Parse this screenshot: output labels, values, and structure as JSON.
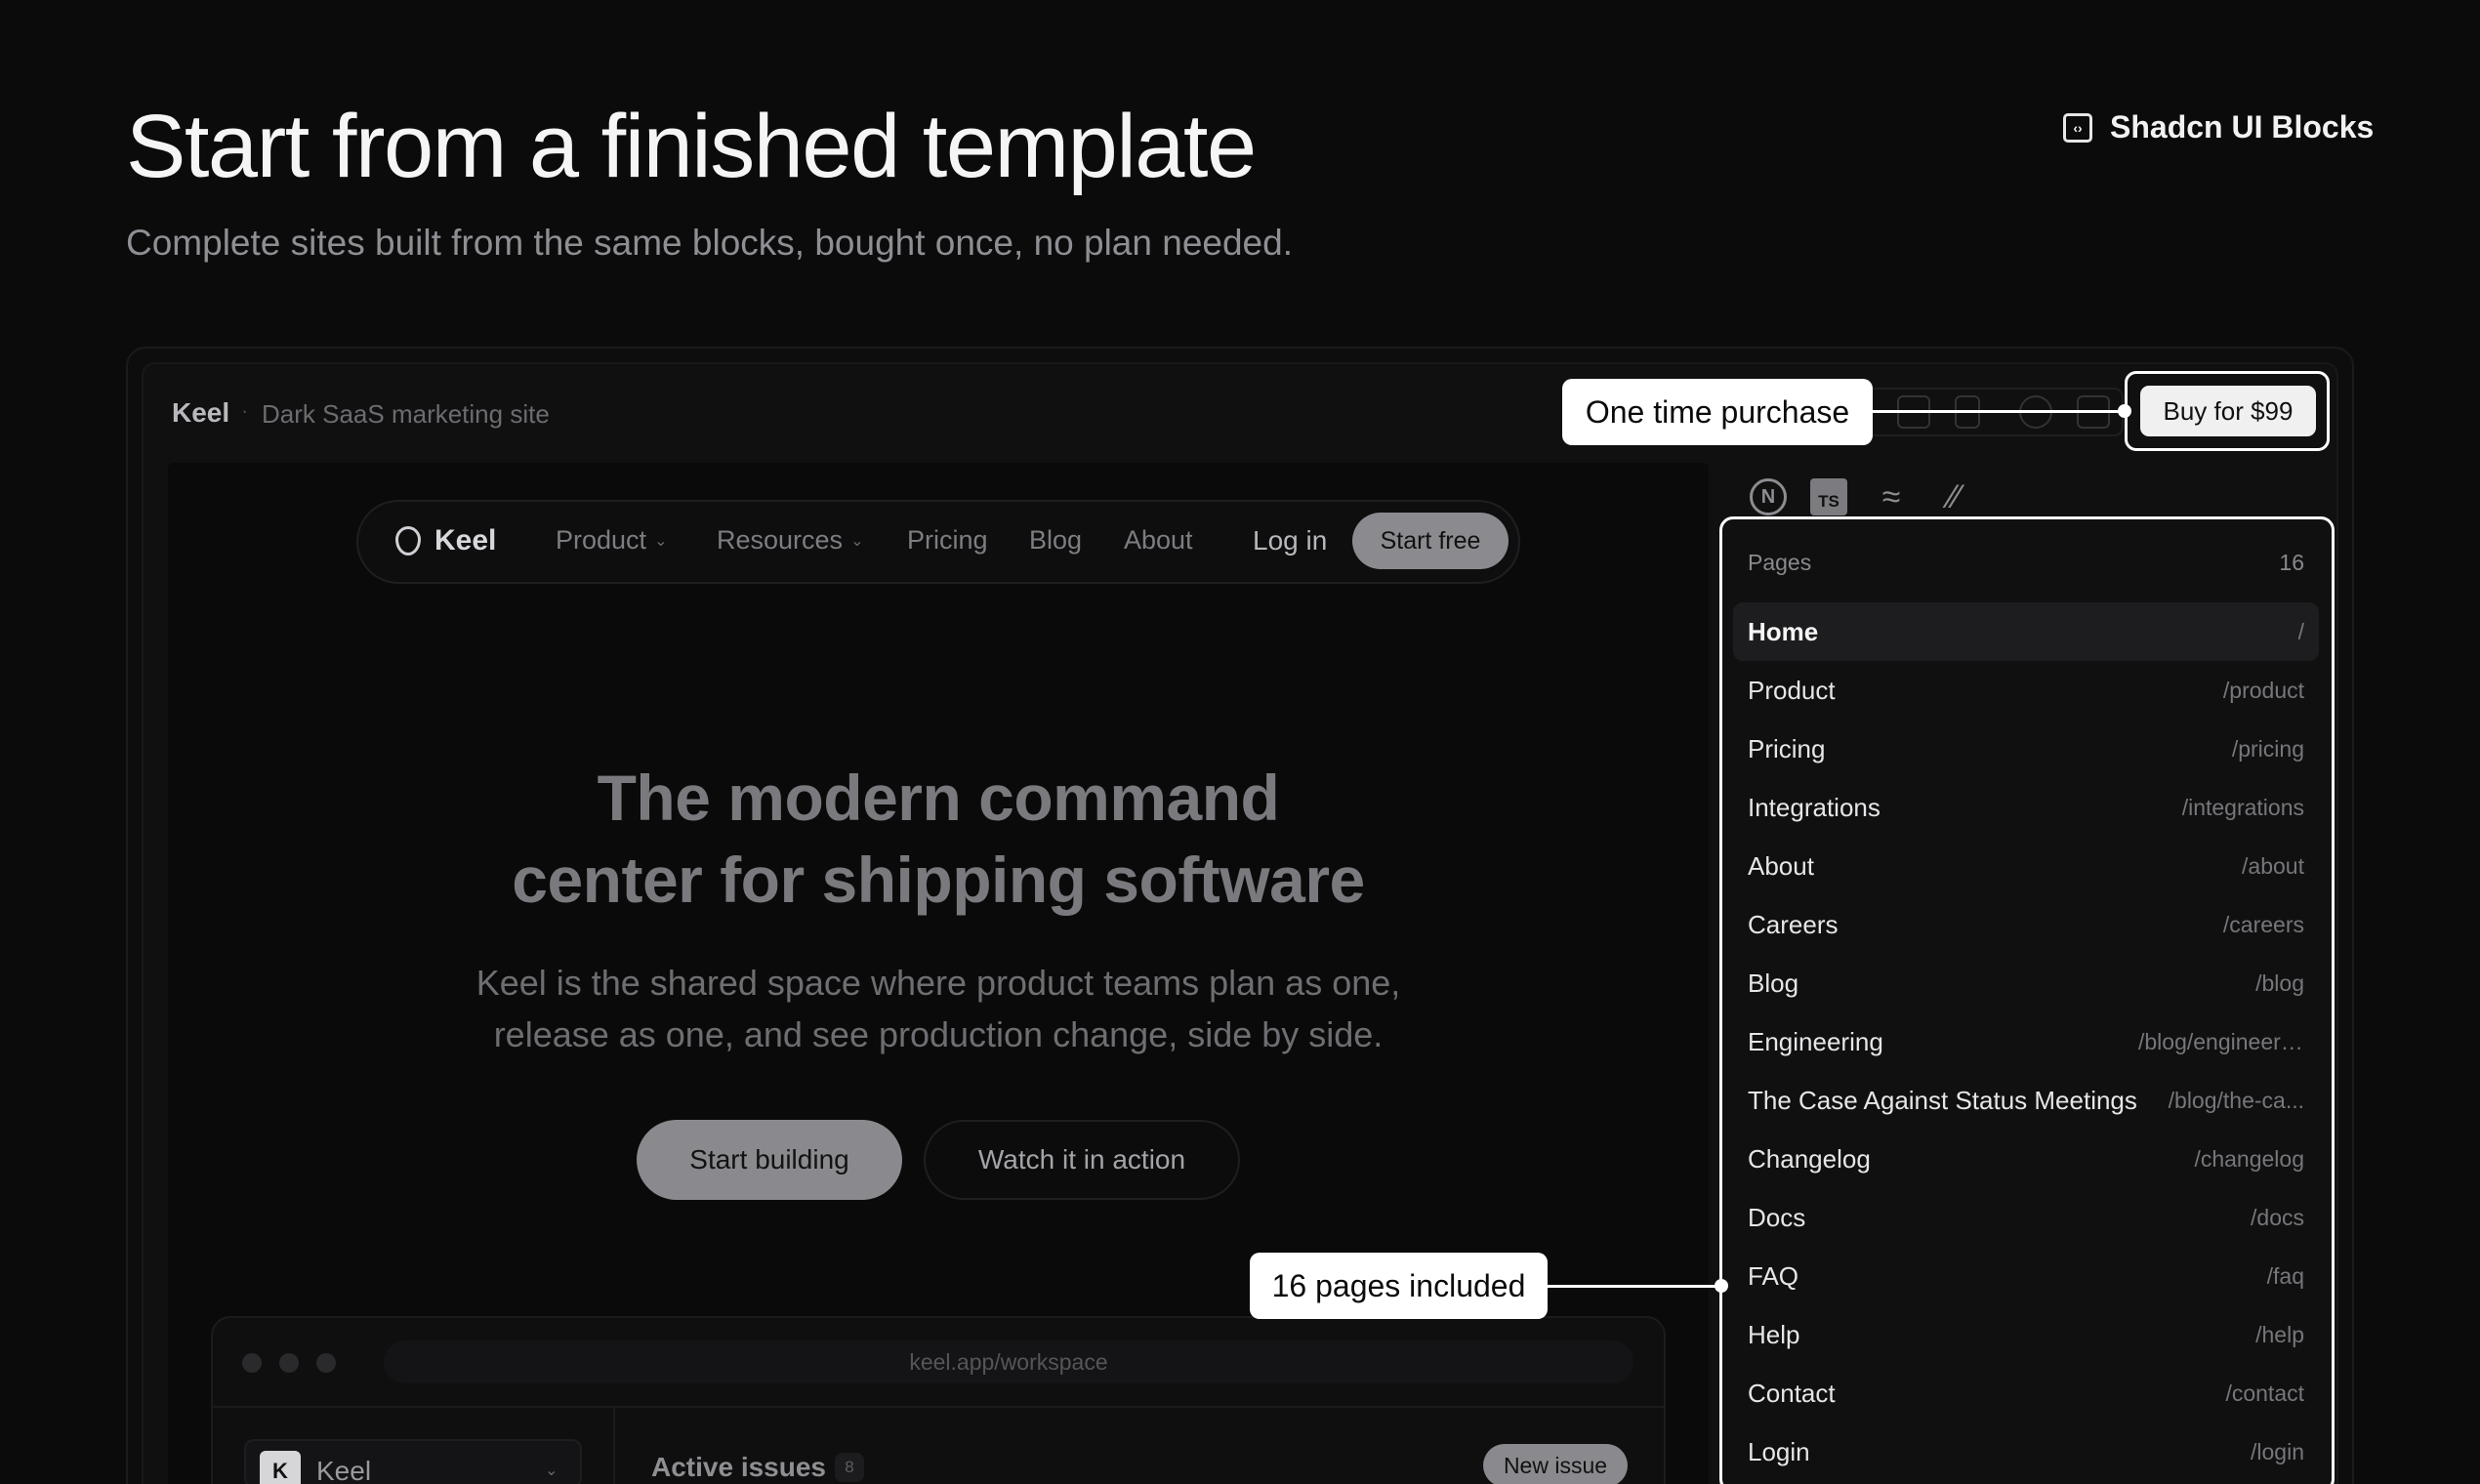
{
  "header": {
    "title": "Start from a finished template",
    "subtitle": "Complete sites built from the same blocks, bought once, no plan needed.",
    "brand_link": "Shadcn UI Blocks"
  },
  "template": {
    "name": "Keel",
    "separator": "·",
    "description": "Dark SaaS marketing site",
    "buy_label": "Buy for $99",
    "callout_purchase": "One time purchase",
    "callout_pages": "16 pages included"
  },
  "preview": {
    "nav": {
      "logo": "Keel",
      "items": [
        {
          "label": "Product",
          "dropdown": true
        },
        {
          "label": "Resources",
          "dropdown": true
        },
        {
          "label": "Pricing",
          "dropdown": false
        },
        {
          "label": "Blog",
          "dropdown": false
        },
        {
          "label": "About",
          "dropdown": false
        }
      ],
      "login": "Log in",
      "cta": "Start free"
    },
    "hero": {
      "title_line1": "The modern command",
      "title_line2": "center for shipping software",
      "body_line1": "Keel is the shared space where product teams plan as one,",
      "body_line2": "release as one, and see production change, side by side.",
      "primary": "Start building",
      "secondary": "Watch it in action"
    },
    "app": {
      "url": "keel.app/workspace",
      "workspace_initial": "K",
      "workspace_name": "Keel",
      "issues_title": "Active issues",
      "issues_count": "8",
      "new_issue": "New issue"
    }
  },
  "stack": {
    "ts_label": "TS"
  },
  "pages": {
    "label": "Pages",
    "count": "16",
    "items": [
      {
        "name": "Home",
        "path": "/",
        "active": true
      },
      {
        "name": "Product",
        "path": "/product"
      },
      {
        "name": "Pricing",
        "path": "/pricing"
      },
      {
        "name": "Integrations",
        "path": "/integrations"
      },
      {
        "name": "About",
        "path": "/about"
      },
      {
        "name": "Careers",
        "path": "/careers"
      },
      {
        "name": "Blog",
        "path": "/blog"
      },
      {
        "name": "Engineering",
        "path": "/blog/engineering"
      },
      {
        "name": "The Case Against Status Meetings",
        "path": "/blog/the-ca..."
      },
      {
        "name": "Changelog",
        "path": "/changelog"
      },
      {
        "name": "Docs",
        "path": "/docs"
      },
      {
        "name": "FAQ",
        "path": "/faq"
      },
      {
        "name": "Help",
        "path": "/help"
      },
      {
        "name": "Contact",
        "path": "/contact"
      },
      {
        "name": "Login",
        "path": "/login"
      }
    ]
  }
}
